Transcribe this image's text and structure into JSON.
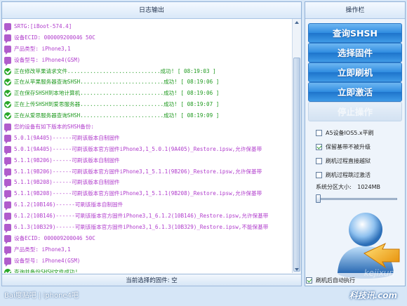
{
  "log_panel": {
    "title": "日志输出",
    "lines": [
      {
        "icon": "bubble",
        "color": "purple",
        "text": "SRTG:[iBoot-574.4]"
      },
      {
        "icon": "bubble",
        "color": "purple",
        "text": "设备ECID: 000009200046 50C"
      },
      {
        "icon": "bubble",
        "color": "purple",
        "text": "产品类型: iPhone3,1"
      },
      {
        "icon": "bubble",
        "color": "purple",
        "text": "设备型号: iPhone4(GSM)"
      },
      {
        "icon": "check",
        "color": "green",
        "text": "正在修改苹果请求文件.............................成功! [ 08:19:03 ]"
      },
      {
        "icon": "check",
        "color": "green",
        "text": "正在从苹果服务器查询SHSH..........................成功! [ 08:19:06 ]"
      },
      {
        "icon": "check",
        "color": "green",
        "text": "正在保存SHSH到本地计算机..........................成功! [ 08:19:06 ]"
      },
      {
        "icon": "check",
        "color": "green",
        "text": "正在上传SHSH到爱思服务器..........................成功! [ 08:19:07 ]"
      },
      {
        "icon": "check",
        "color": "green",
        "text": "正在从爱思服务器查询SHSH..........................成功! [ 08:19:09 ]"
      },
      {
        "icon": "bubble",
        "color": "purple",
        "text": "您的设备有如下版本的SHSH备份:"
      },
      {
        "icon": "bubble",
        "color": "purple",
        "text": "5.0.1(9A405)------可刷该版本自制固件"
      },
      {
        "icon": "bubble",
        "color": "purple",
        "text": "5.0.1(9A405)------可刷该版本官方固件iPhone3,1_5.0.1(9A405)_Restore.ipsw,允许保基带"
      },
      {
        "icon": "bubble",
        "color": "purple",
        "text": "5.1.1(9B206)------可刷该版本自制固件"
      },
      {
        "icon": "bubble",
        "color": "purple",
        "text": "5.1.1(9B206)------可刷该版本官方固件iPhone3,1_5.1.1(9B206)_Restore.ipsw,允许保基带"
      },
      {
        "icon": "bubble",
        "color": "purple",
        "text": "5.1.1(9B208)------可刷该版本自制固件"
      },
      {
        "icon": "bubble",
        "color": "purple",
        "text": "5.1.1(9B208)------可刷该版本官方固件iPhone3,1_5.1.1(9B208)_Restore.ipsw,允许保基带"
      },
      {
        "icon": "bubble",
        "color": "purple",
        "text": "6.1.2(10B146)------可刷该版本自制固件"
      },
      {
        "icon": "bubble",
        "color": "purple",
        "text": "6.1.2(10B146)------可刷该版本官方固件iPhone3,1_6.1.2(10B146)_Restore.ipsw,允许保基带"
      },
      {
        "icon": "bubble",
        "color": "purple",
        "text": "6.1.3(10B329)------可刷该版本官方固件iPhone3,1_6.1.3(10B329)_Restore.ipsw,不能保基带"
      },
      {
        "icon": "bubble",
        "color": "purple",
        "text": "设备ECID: 000009200046 50C"
      },
      {
        "icon": "bubble",
        "color": "purple",
        "text": "产品类型: iPhone3,1"
      },
      {
        "icon": "bubble",
        "color": "purple",
        "text": "设备型号: iPhone4(GSM)"
      },
      {
        "icon": "check",
        "color": "green",
        "text": "查询并备份SHSH文件成功!"
      }
    ]
  },
  "status_bar": {
    "text": "当前选择的固件: 空"
  },
  "op_panel": {
    "title": "操作栏",
    "buttons": {
      "query_shsh": "查询SHSH",
      "select_firmware": "选择固件",
      "flash_now": "立即刷机",
      "activate_now": "立即激活",
      "stop": "停止操作"
    },
    "options": {
      "a5_ios5": {
        "label": "A5设备IOS5.x平刷",
        "checked": false
      },
      "keep_baseband": {
        "label": "保留基带不被升级",
        "checked": true
      },
      "jailbreak_during_flash": {
        "label": "刷机过程直接越狱",
        "checked": false
      },
      "skip_activation": {
        "label": "刷机过程跳过激活",
        "checked": false
      }
    },
    "partition": {
      "label": "系统分区大小:",
      "value": "1024MB",
      "level": 0.0
    },
    "auto_flash": {
      "label": "刷机后自动执行",
      "checked": true
    }
  },
  "watermarks": {
    "baidu": "Bai度贴吧 | iphone4吧",
    "site": "科技讯.com",
    "site_en": "kejixun"
  },
  "colors": {
    "accent": "#2f8ce0",
    "log_purple": "#b03ccc",
    "log_green": "#1f9a1f"
  }
}
